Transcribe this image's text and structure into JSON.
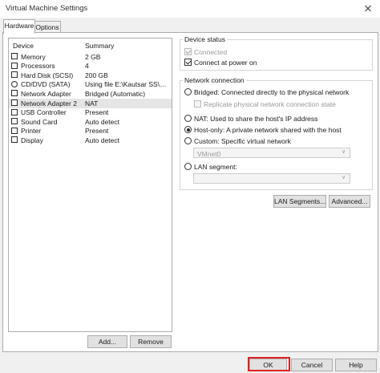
{
  "window": {
    "title": "Virtual Machine Settings"
  },
  "tabs": [
    {
      "label": "Hardware",
      "active": true
    },
    {
      "label": "Options",
      "active": false
    }
  ],
  "device_list": {
    "columns": [
      "Device",
      "Summary"
    ],
    "rows": [
      {
        "device": "Memory",
        "summary": "2 GB",
        "icon": "memory-icon"
      },
      {
        "device": "Processors",
        "summary": "4",
        "icon": "processor-icon"
      },
      {
        "device": "Hard Disk (SCSI)",
        "summary": "200 GB",
        "icon": "hard-disk-icon"
      },
      {
        "device": "CD/DVD (SATA)",
        "summary": "Using file E:\\Kautsar SS\\q\\wi...",
        "icon": "cd-dvd-icon"
      },
      {
        "device": "Network Adapter",
        "summary": "Bridged (Automatic)",
        "icon": "network-adapter-icon"
      },
      {
        "device": "Network Adapter 2",
        "summary": "NAT",
        "icon": "network-adapter-icon",
        "selected": true
      },
      {
        "device": "USB Controller",
        "summary": "Present",
        "icon": "usb-icon"
      },
      {
        "device": "Sound Card",
        "summary": "Auto detect",
        "icon": "sound-card-icon"
      },
      {
        "device": "Printer",
        "summary": "Present",
        "icon": "printer-icon"
      },
      {
        "device": "Display",
        "summary": "Auto detect",
        "icon": "display-icon"
      }
    ]
  },
  "list_buttons": {
    "add": "Add...",
    "remove": "Remove"
  },
  "device_status": {
    "legend": "Device status",
    "connected": "Connected",
    "connect_at_power_on": "Connect at power on"
  },
  "network_connection": {
    "legend": "Network connection",
    "bridged": "Bridged: Connected directly to the physical network",
    "replicate": "Replicate physical network connection state",
    "nat": "NAT: Used to share the host's IP address",
    "host_only": "Host-only: A private network shared with the host",
    "custom": "Custom: Specific virtual network",
    "custom_select_value": "VMnet0",
    "lan_segment": "LAN segment:",
    "lan_select_value": ""
  },
  "panel_buttons": {
    "lan_segments": "LAN Segments...",
    "advanced": "Advanced..."
  },
  "footer": {
    "ok": "OK",
    "cancel": "Cancel",
    "help": "Help"
  },
  "colors": {
    "highlight_border": "#e02020",
    "selection_row": "#e5e5e5"
  }
}
